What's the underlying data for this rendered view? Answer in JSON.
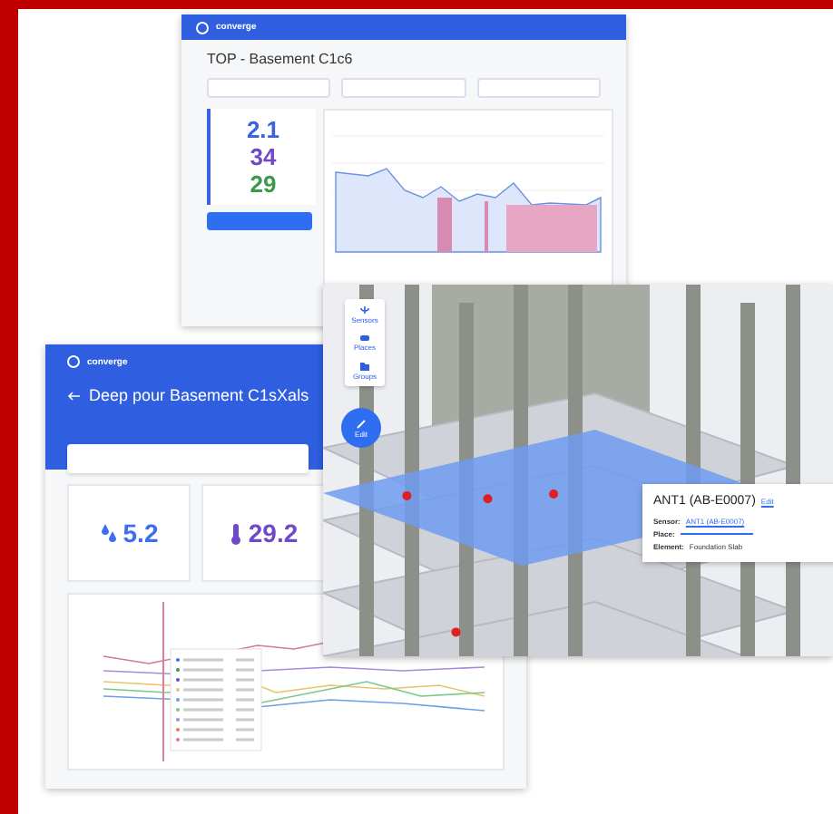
{
  "dashboard": {
    "logo": "converge",
    "title": "TOP - Basement C1c6",
    "stats": [
      {
        "value": "2.1",
        "color": "#3b63e0"
      },
      {
        "value": "34",
        "color": "#7048c8"
      },
      {
        "value": "29",
        "color": "#3a9a4a"
      }
    ]
  },
  "analysis": {
    "logo": "converge",
    "title": "Deep pour Basement C1sXals",
    "cards": [
      {
        "value": "5.2",
        "color": "#3b6ef0",
        "kind": "drops"
      },
      {
        "value": "29.2",
        "color": "#7048c8",
        "kind": "thermometer"
      }
    ]
  },
  "viewer": {
    "tools": [
      {
        "label": "Sensors",
        "kind": "sensor"
      },
      {
        "label": "Places",
        "kind": "place"
      },
      {
        "label": "Groups",
        "kind": "group"
      }
    ],
    "edit_button": "Edit",
    "popup": {
      "title": "ANT1 (AB-E0007)",
      "action": "Edit",
      "fields": [
        {
          "label": "Sensor:",
          "value": "ANT1 (AB-E0007)",
          "kind": "link"
        },
        {
          "label": "Place:",
          "kind": "link"
        },
        {
          "label": "Element:",
          "value": "Foundation Slab",
          "kind": "text"
        }
      ]
    }
  }
}
